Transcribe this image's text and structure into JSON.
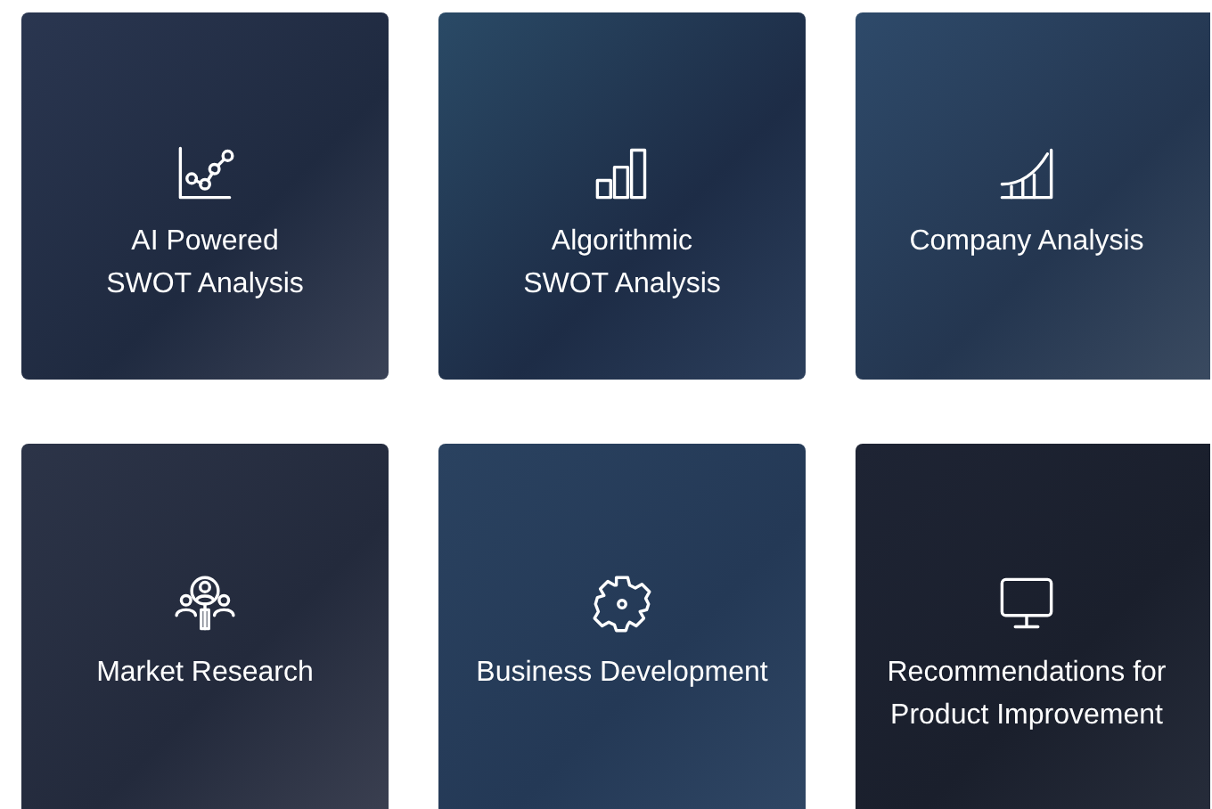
{
  "cards": [
    {
      "title": [
        "AI Powered",
        "SWOT Analysis"
      ]
    },
    {
      "title": [
        "Algorithmic",
        "SWOT Analysis"
      ]
    },
    {
      "title": [
        "Company Analysis"
      ]
    },
    {
      "title": [
        "Market Research"
      ]
    },
    {
      "title": [
        "Business Development"
      ]
    },
    {
      "title": [
        "Recommendations for",
        "Product Improvement"
      ]
    }
  ]
}
